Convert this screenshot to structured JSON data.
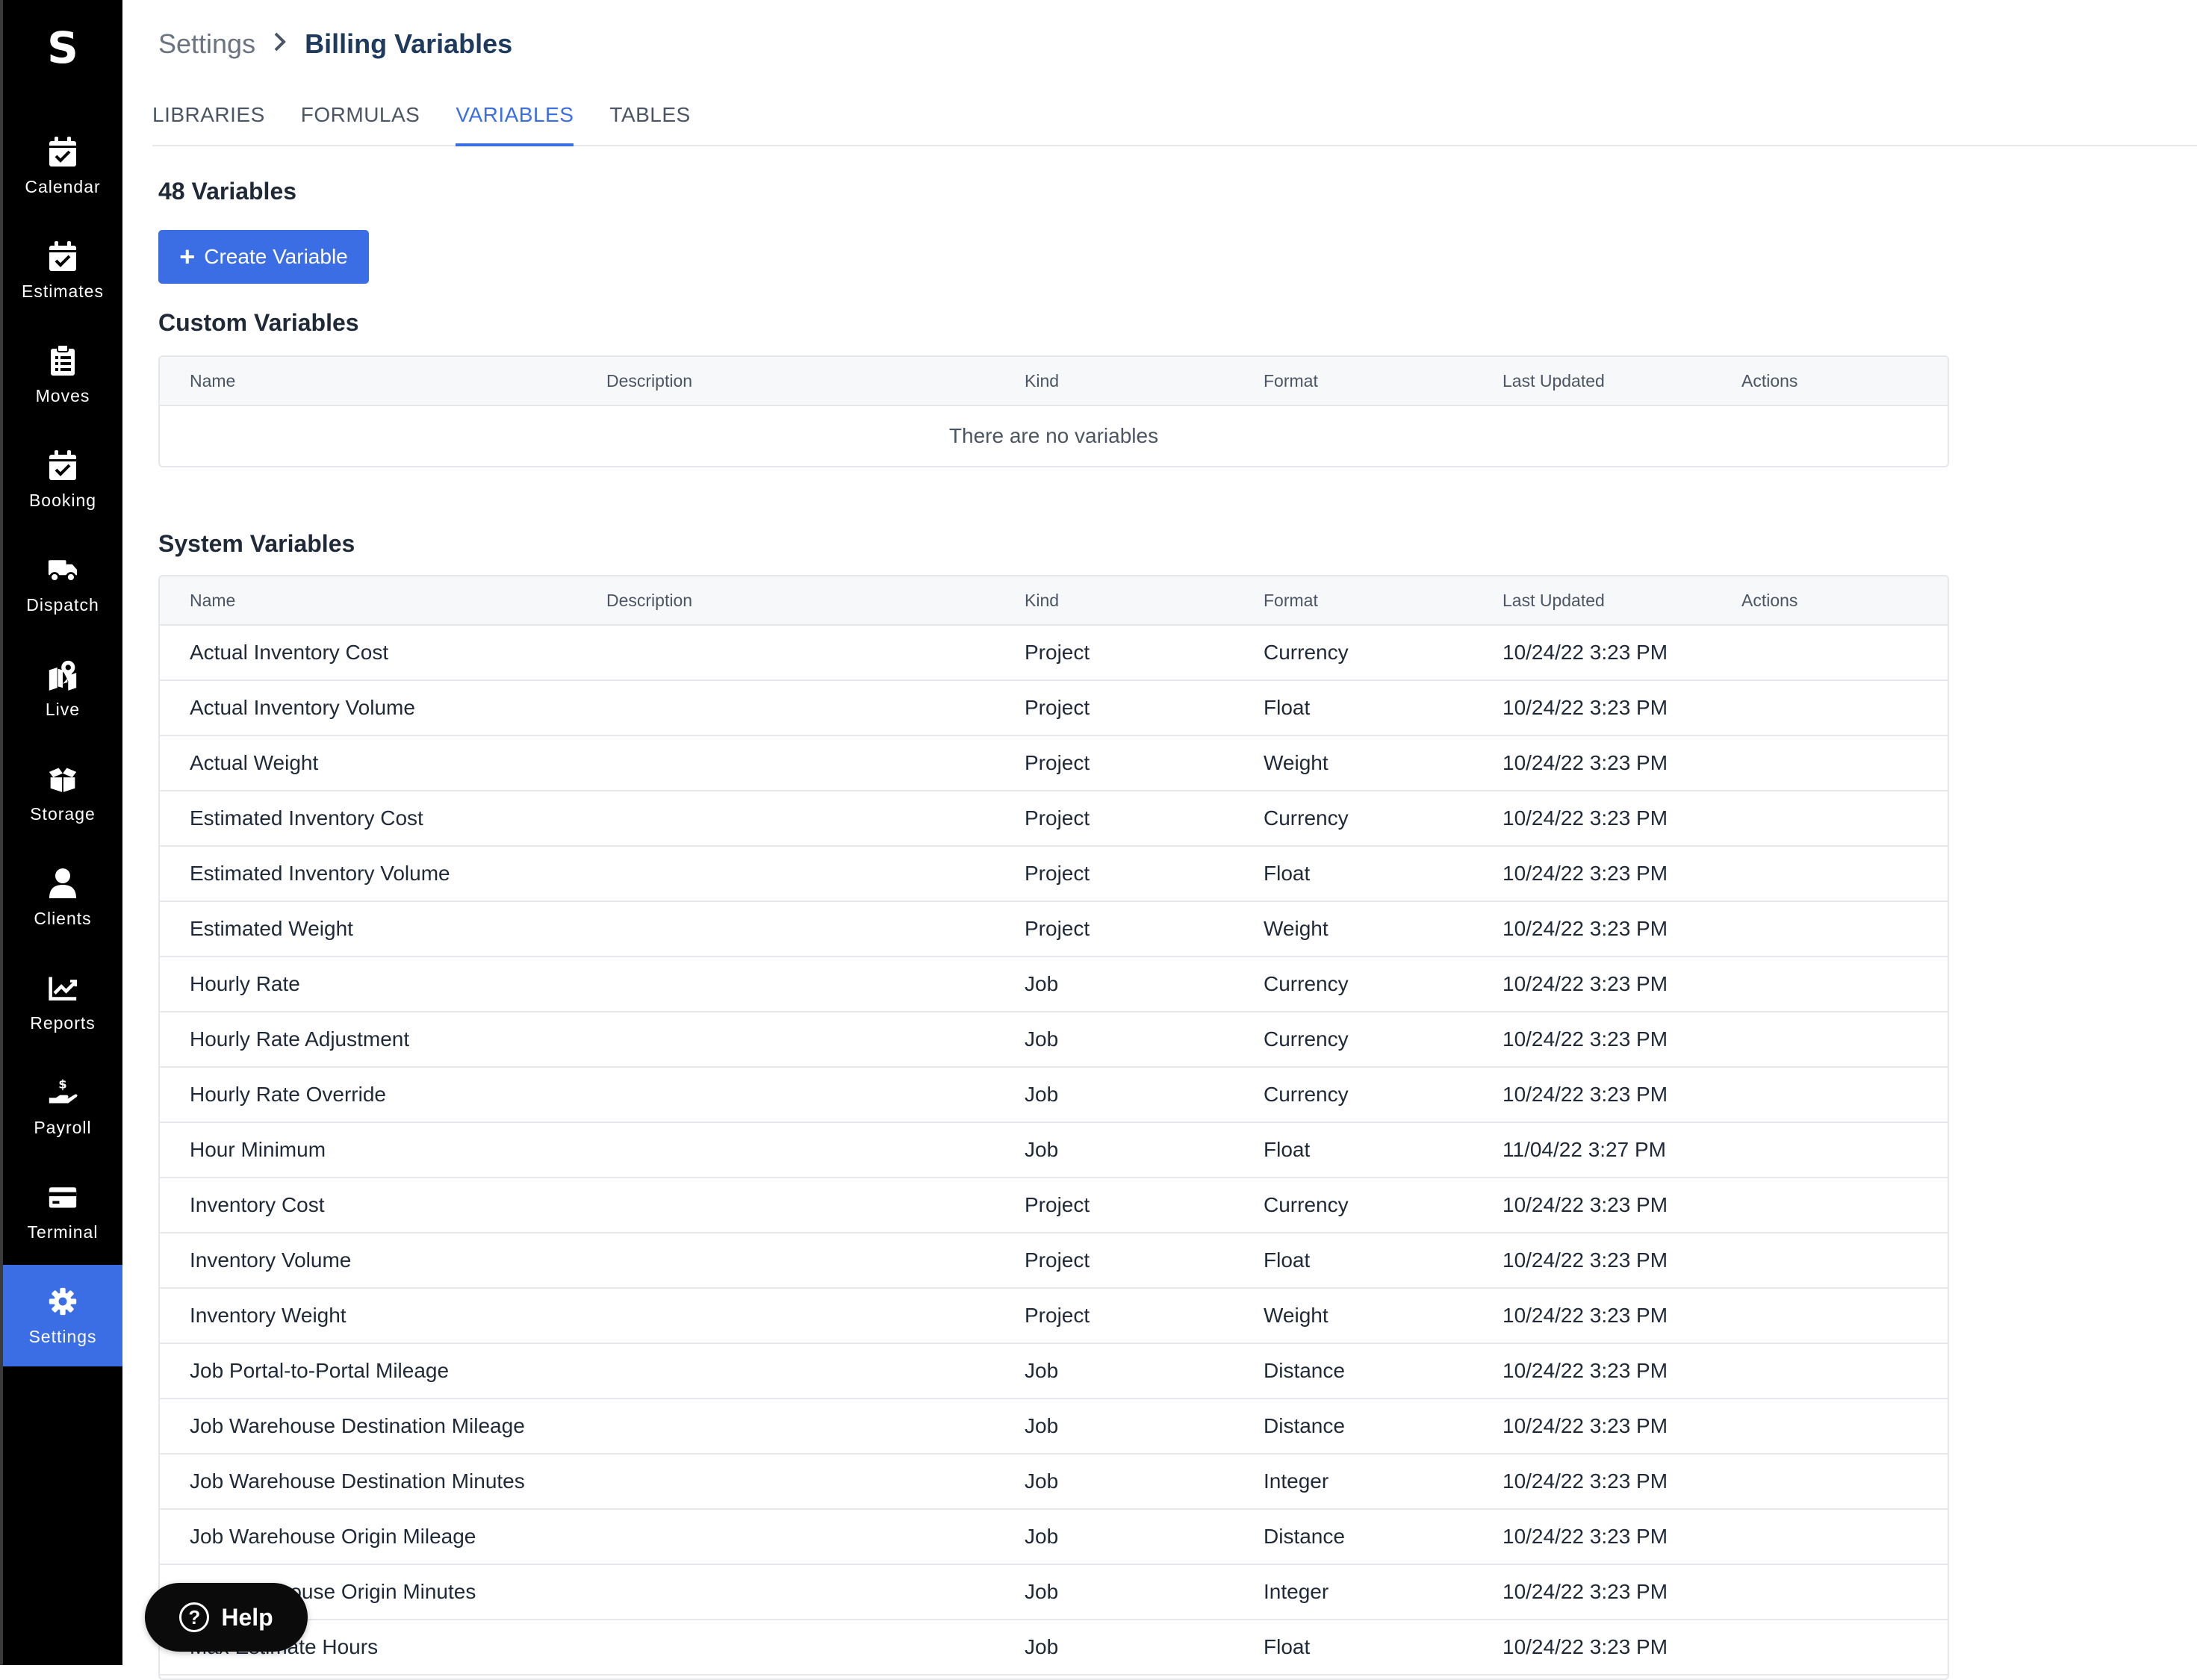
{
  "app": {
    "logo": "S"
  },
  "sidebar": {
    "items": [
      {
        "label": "Calendar",
        "icon": "calendar-check-icon"
      },
      {
        "label": "Estimates",
        "icon": "calendar-check-icon"
      },
      {
        "label": "Moves",
        "icon": "clipboard-list-icon"
      },
      {
        "label": "Booking",
        "icon": "calendar-check-icon"
      },
      {
        "label": "Dispatch",
        "icon": "truck-icon"
      },
      {
        "label": "Live",
        "icon": "map-pin-icon"
      },
      {
        "label": "Storage",
        "icon": "box-open-icon"
      },
      {
        "label": "Clients",
        "icon": "user-icon"
      },
      {
        "label": "Reports",
        "icon": "chart-line-icon"
      },
      {
        "label": "Payroll",
        "icon": "hand-dollar-icon"
      },
      {
        "label": "Terminal",
        "icon": "credit-card-icon"
      },
      {
        "label": "Settings",
        "icon": "gear-icon",
        "active": true
      }
    ],
    "active_color": "#3b6ee5"
  },
  "breadcrumb": {
    "root": "Settings",
    "current": "Billing Variables"
  },
  "tabs": [
    {
      "label": "LIBRARIES"
    },
    {
      "label": "FORMULAS"
    },
    {
      "label": "VARIABLES",
      "active": true
    },
    {
      "label": "TABLES"
    }
  ],
  "variables_count": "48 Variables",
  "create_button": {
    "label": "Create Variable"
  },
  "columns": [
    "Name",
    "Description",
    "Kind",
    "Format",
    "Last Updated",
    "Actions"
  ],
  "custom_variables": {
    "title": "Custom Variables",
    "empty_text": "There are no variables"
  },
  "system_variables": {
    "title": "System Variables",
    "rows": [
      {
        "name": "Actual Inventory Cost",
        "description": "",
        "kind": "Project",
        "format": "Currency",
        "updated": "10/24/22 3:23 PM"
      },
      {
        "name": "Actual Inventory Volume",
        "description": "",
        "kind": "Project",
        "format": "Float",
        "updated": "10/24/22 3:23 PM"
      },
      {
        "name": "Actual Weight",
        "description": "",
        "kind": "Project",
        "format": "Weight",
        "updated": "10/24/22 3:23 PM"
      },
      {
        "name": "Estimated Inventory Cost",
        "description": "",
        "kind": "Project",
        "format": "Currency",
        "updated": "10/24/22 3:23 PM"
      },
      {
        "name": "Estimated Inventory Volume",
        "description": "",
        "kind": "Project",
        "format": "Float",
        "updated": "10/24/22 3:23 PM"
      },
      {
        "name": "Estimated Weight",
        "description": "",
        "kind": "Project",
        "format": "Weight",
        "updated": "10/24/22 3:23 PM"
      },
      {
        "name": "Hourly Rate",
        "description": "",
        "kind": "Job",
        "format": "Currency",
        "updated": "10/24/22 3:23 PM"
      },
      {
        "name": "Hourly Rate Adjustment",
        "description": "",
        "kind": "Job",
        "format": "Currency",
        "updated": "10/24/22 3:23 PM"
      },
      {
        "name": "Hourly Rate Override",
        "description": "",
        "kind": "Job",
        "format": "Currency",
        "updated": "10/24/22 3:23 PM"
      },
      {
        "name": "Hour Minimum",
        "description": "",
        "kind": "Job",
        "format": "Float",
        "updated": "11/04/22 3:27 PM"
      },
      {
        "name": "Inventory Cost",
        "description": "",
        "kind": "Project",
        "format": "Currency",
        "updated": "10/24/22 3:23 PM"
      },
      {
        "name": "Inventory Volume",
        "description": "",
        "kind": "Project",
        "format": "Float",
        "updated": "10/24/22 3:23 PM"
      },
      {
        "name": "Inventory Weight",
        "description": "",
        "kind": "Project",
        "format": "Weight",
        "updated": "10/24/22 3:23 PM"
      },
      {
        "name": "Job Portal-to-Portal Mileage",
        "description": "",
        "kind": "Job",
        "format": "Distance",
        "updated": "10/24/22 3:23 PM"
      },
      {
        "name": "Job Warehouse Destination Mileage",
        "description": "",
        "kind": "Job",
        "format": "Distance",
        "updated": "10/24/22 3:23 PM"
      },
      {
        "name": "Job Warehouse Destination Minutes",
        "description": "",
        "kind": "Job",
        "format": "Integer",
        "updated": "10/24/22 3:23 PM"
      },
      {
        "name": "Job Warehouse Origin Mileage",
        "description": "",
        "kind": "Job",
        "format": "Distance",
        "updated": "10/24/22 3:23 PM"
      },
      {
        "name": "Job Warehouse Origin Minutes",
        "description": "",
        "kind": "Job",
        "format": "Integer",
        "updated": "10/24/22 3:23 PM"
      },
      {
        "name": "Max Estimate Hours",
        "description": "",
        "kind": "Job",
        "format": "Float",
        "updated": "10/24/22 3:23 PM"
      }
    ]
  },
  "help_button": {
    "label": "Help",
    "icon": "question-circle-icon"
  }
}
